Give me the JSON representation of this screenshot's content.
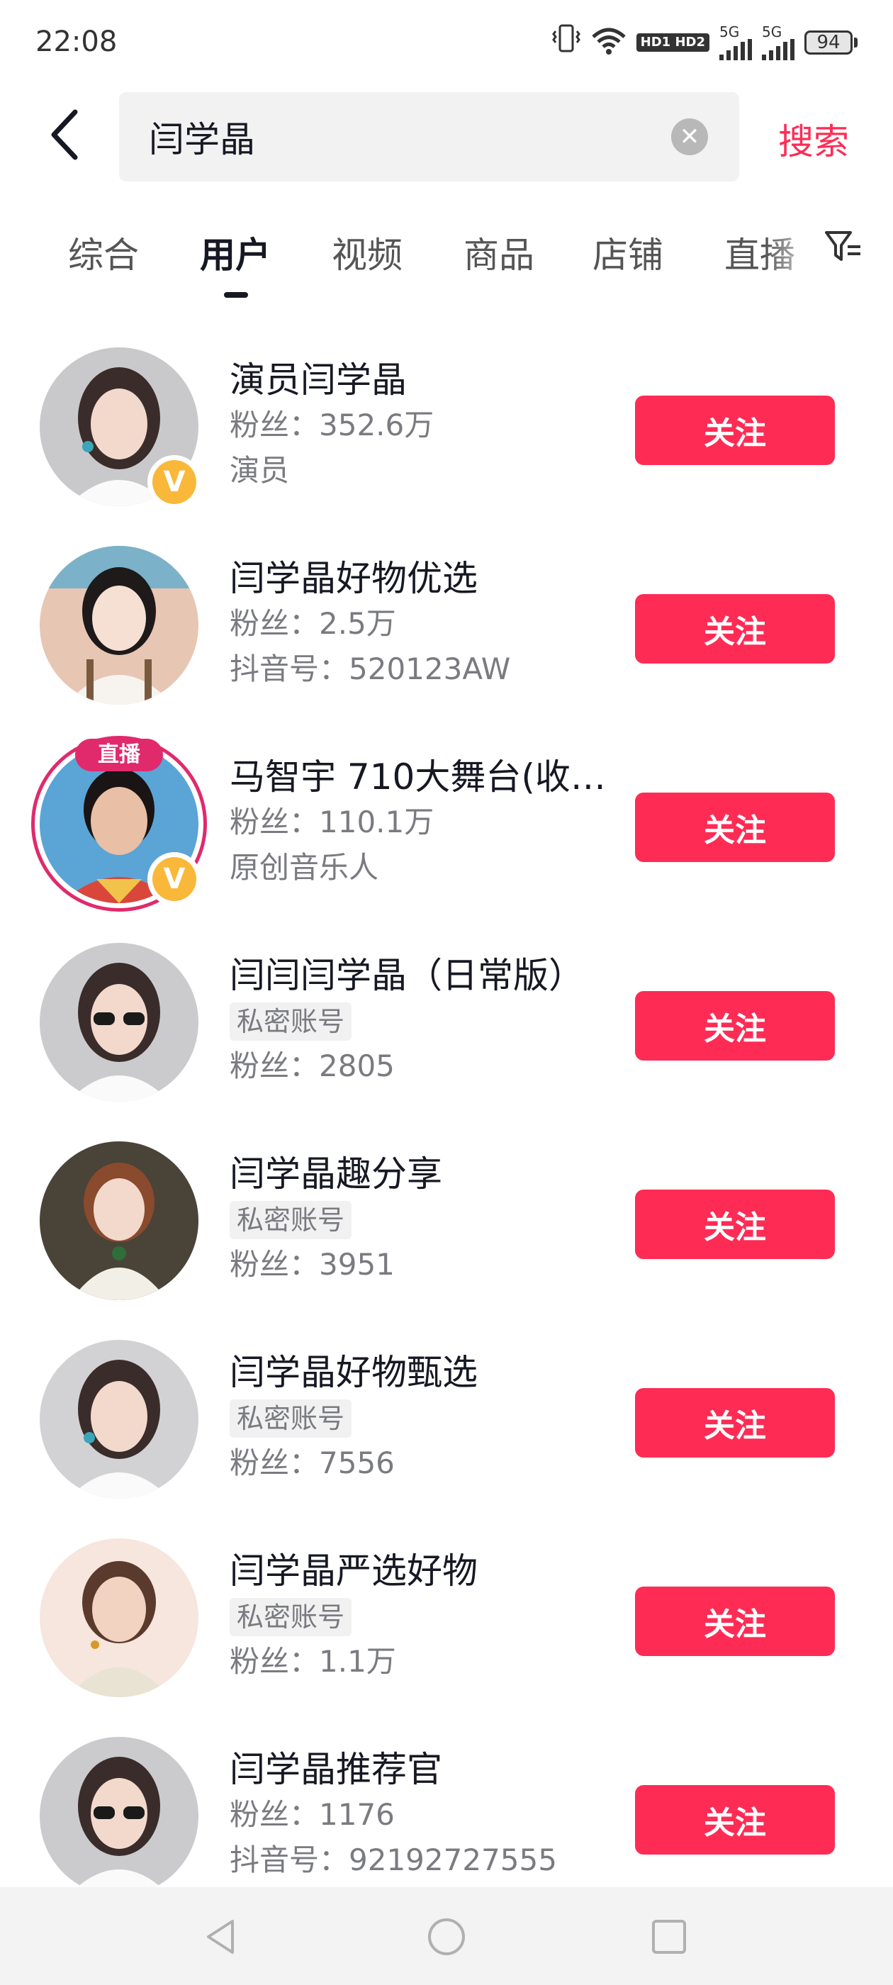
{
  "status_bar": {
    "time": "22:08",
    "hd_label": "HD1 HD2",
    "network_1": "5G",
    "network_2": "5G",
    "battery": "94"
  },
  "search": {
    "query": "闫学晶",
    "submit_label": "搜索"
  },
  "tabs": [
    {
      "label": "综合",
      "active": false
    },
    {
      "label": "用户",
      "active": true
    },
    {
      "label": "视频",
      "active": false
    },
    {
      "label": "商品",
      "active": false
    },
    {
      "label": "店铺",
      "active": false
    },
    {
      "label": "直播",
      "active": false
    }
  ],
  "users": [
    {
      "name": "演员闫学晶",
      "fans": "粉丝：352.6万",
      "extra": "演员",
      "private_tag": "",
      "follow_label": "关注",
      "verified": true,
      "live": false
    },
    {
      "name": "闫学晶好物优选",
      "fans": "粉丝：2.5万",
      "extra": "抖音号：520123AW",
      "private_tag": "",
      "follow_label": "关注",
      "verified": false,
      "live": false
    },
    {
      "name": "马智宇 710大舞台(收…",
      "fans": "粉丝：110.1万",
      "extra": "原创音乐人",
      "private_tag": "",
      "follow_label": "关注",
      "verified": true,
      "live": true,
      "live_label": "直播"
    },
    {
      "name": "闫闫闫学晶（日常版）",
      "fans": "粉丝：2805",
      "extra": "",
      "private_tag": "私密账号",
      "follow_label": "关注",
      "verified": false,
      "live": false
    },
    {
      "name": "闫学晶趣分享",
      "fans": "粉丝：3951",
      "extra": "",
      "private_tag": "私密账号",
      "follow_label": "关注",
      "verified": false,
      "live": false
    },
    {
      "name": "闫学晶好物甄选",
      "fans": "粉丝：7556",
      "extra": "",
      "private_tag": "私密账号",
      "follow_label": "关注",
      "verified": false,
      "live": false
    },
    {
      "name": "闫学晶严选好物",
      "fans": "粉丝：1.1万",
      "extra": "",
      "private_tag": "私密账号",
      "follow_label": "关注",
      "verified": false,
      "live": false
    },
    {
      "name": "闫学晶推荐官",
      "fans": "粉丝：1176",
      "extra": "抖音号：92192727555",
      "private_tag": "",
      "follow_label": "关注",
      "verified": false,
      "live": false
    }
  ],
  "verify_symbol": "V",
  "colors": {
    "accent": "#fe2c55",
    "live": "#e02a6c",
    "verify": "#f9b83a"
  }
}
